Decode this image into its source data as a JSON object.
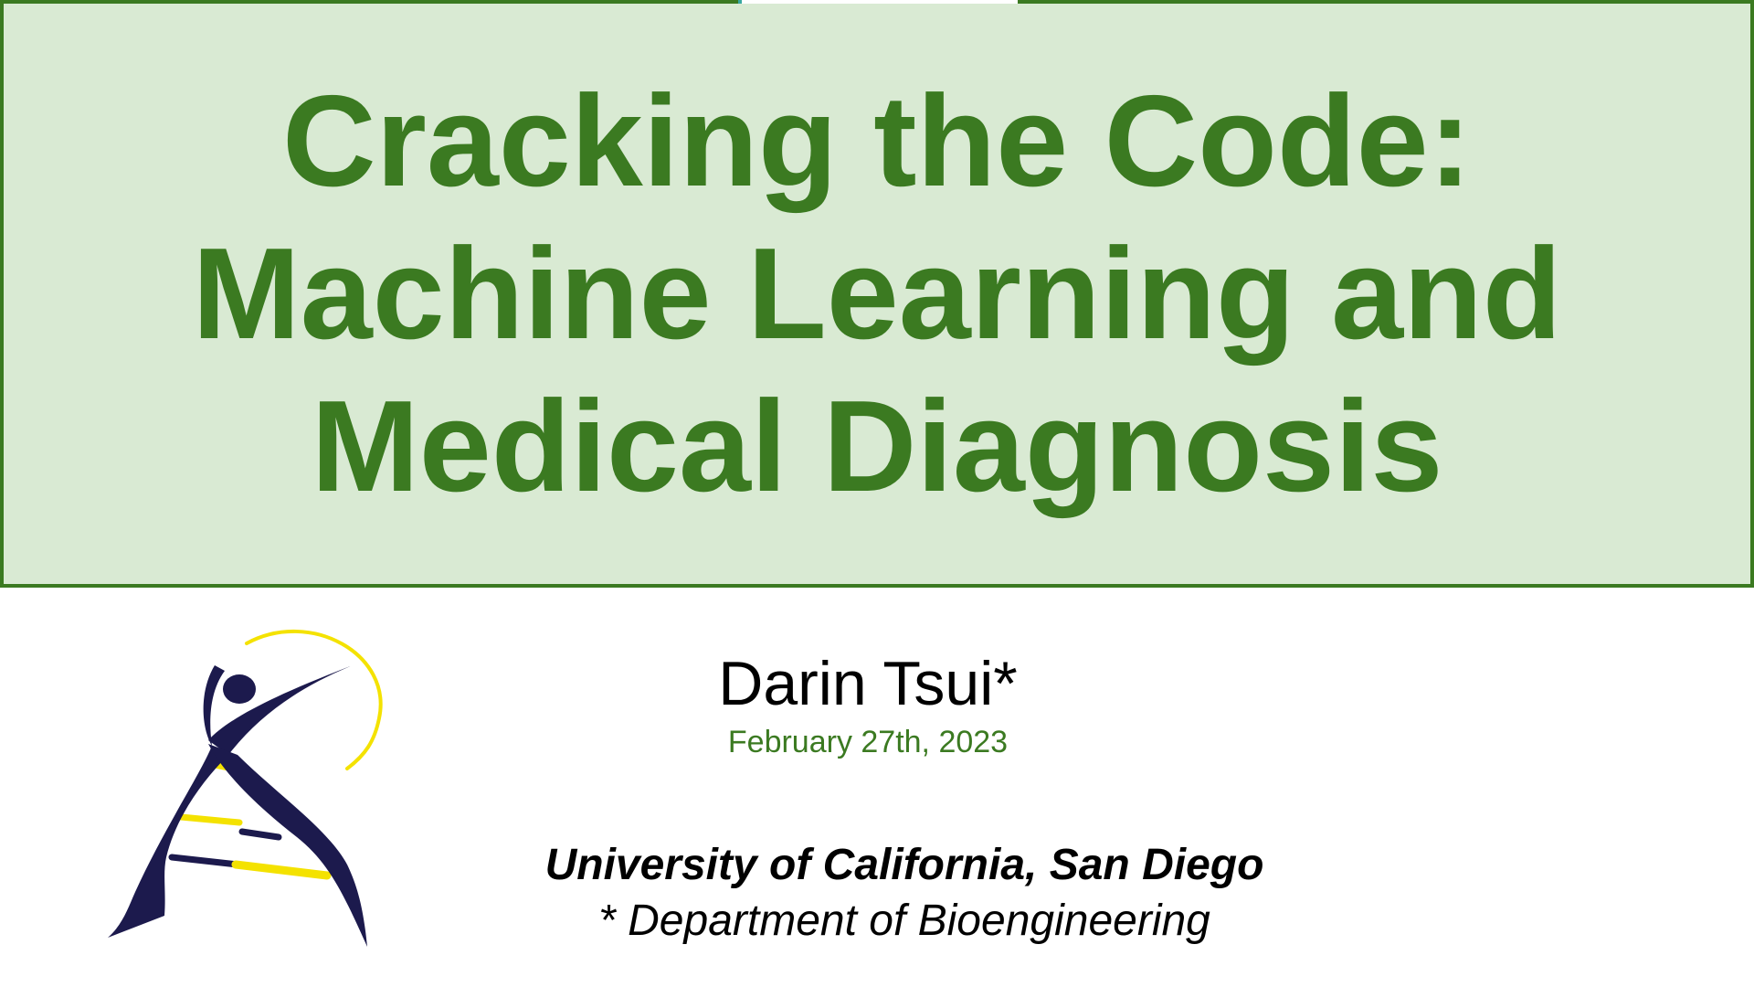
{
  "title": {
    "lines": [
      "Cracking the Code:",
      "Machine Learning and",
      "Medical Diagnosis"
    ]
  },
  "author": {
    "name": "Darin Tsui*",
    "date": "February 27th, 2023"
  },
  "affiliation": {
    "university": "University of California, San Diego",
    "department": "* Department of Bioengineering"
  },
  "logo": {
    "icon": "dna-figure-logo-icon",
    "colors": {
      "navy": "#1c1a4d",
      "yellow": "#f4e200"
    }
  },
  "colors": {
    "title_green": "#3b7a21",
    "title_box_fill": "#d9ead3"
  }
}
